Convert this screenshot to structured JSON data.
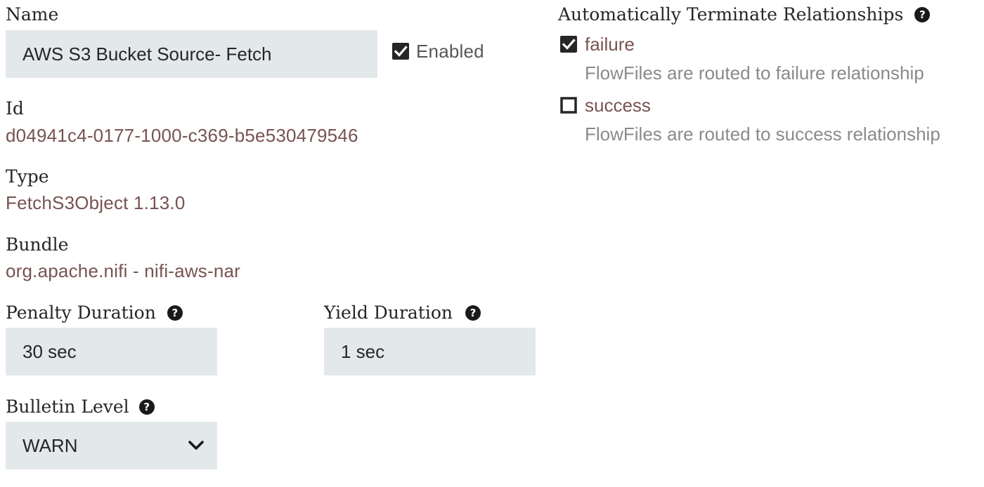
{
  "name": {
    "label": "Name",
    "value": "AWS S3 Bucket Source- Fetch"
  },
  "enabled": {
    "label": "Enabled",
    "checked": true
  },
  "id": {
    "label": "Id",
    "value": "d04941c4-0177-1000-c369-b5e530479546"
  },
  "type": {
    "label": "Type",
    "value": "FetchS3Object 1.13.0"
  },
  "bundle": {
    "label": "Bundle",
    "value": "org.apache.nifi - nifi-aws-nar"
  },
  "penalty_duration": {
    "label": "Penalty Duration",
    "value": "30 sec"
  },
  "yield_duration": {
    "label": "Yield Duration",
    "value": "1 sec"
  },
  "bulletin_level": {
    "label": "Bulletin Level",
    "selected": "WARN"
  },
  "auto_terminate": {
    "label": "Automatically Terminate Relationships",
    "relationships": [
      {
        "name": "failure",
        "description": "FlowFiles are routed to failure relationship",
        "checked": true
      },
      {
        "name": "success",
        "description": "FlowFiles are routed to success relationship",
        "checked": false
      }
    ]
  },
  "icons": {
    "help": "help-circle-icon",
    "checked": "checkbox-checked-icon",
    "unchecked": "checkbox-unchecked-icon",
    "dropdown": "chevron-down-icon"
  },
  "colors": {
    "field_bg": "#e3e8eb",
    "value_text": "#775351",
    "description_text": "#8a8a8a"
  }
}
